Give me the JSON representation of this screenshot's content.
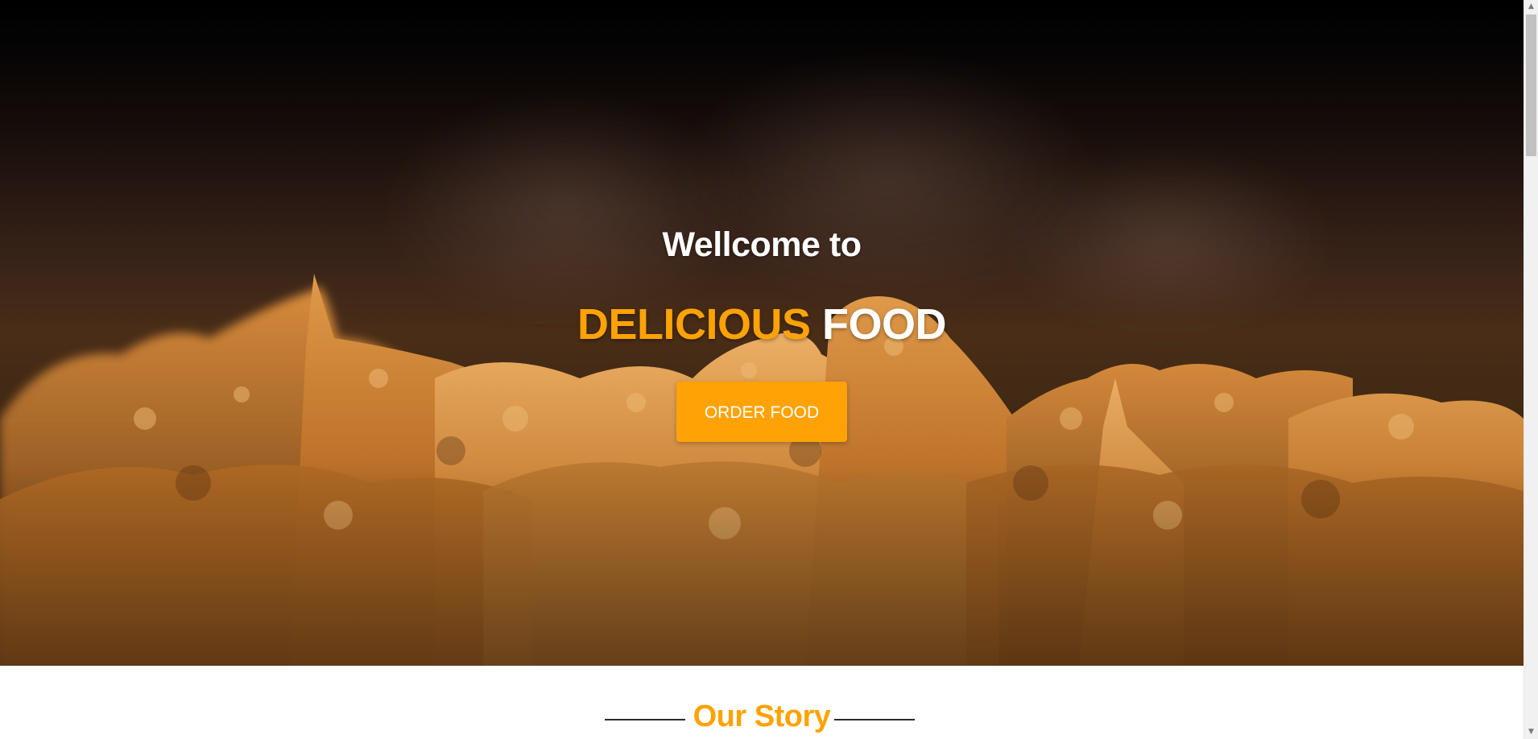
{
  "hero": {
    "welcome": "Wellcome to",
    "headline_accent": "DELICIOUS",
    "headline_plain": "FOOD",
    "order_button": "ORDER FOOD",
    "background_image": "fried-chicken-photo"
  },
  "story": {
    "title": "Our Story"
  },
  "colors": {
    "accent": "#ffa205",
    "hero_text": "#ffffff",
    "line": "#2b2b2b"
  },
  "icons": {
    "scroll_up": "chevron-up-icon",
    "scroll_down": "chevron-down-icon"
  }
}
